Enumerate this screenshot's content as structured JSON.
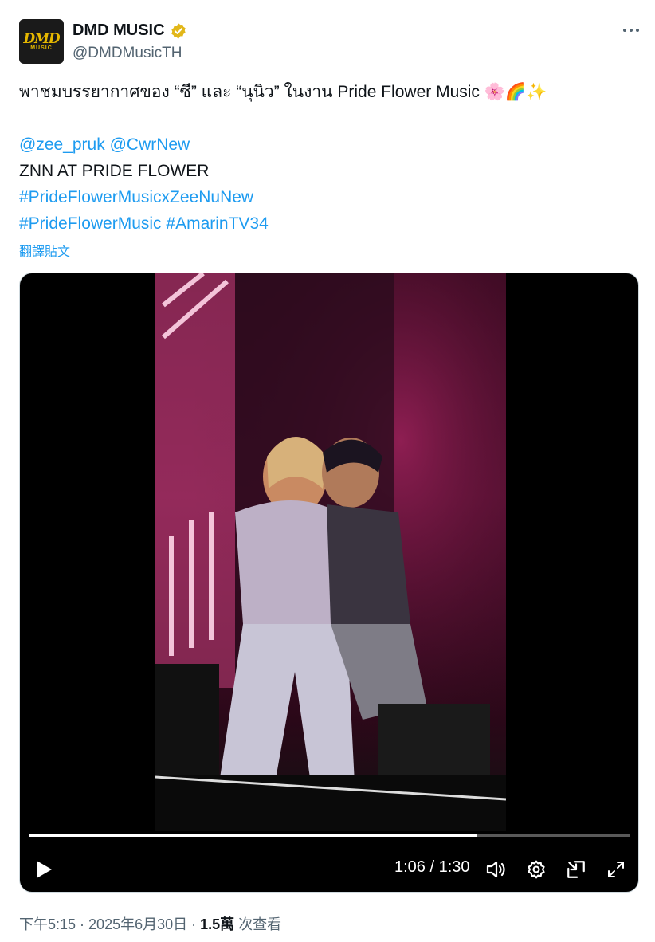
{
  "author": {
    "name": "DMD MUSIC",
    "handle": "@DMDMusicTH",
    "avatar_logo": "DMD",
    "avatar_sub": "MUSIC",
    "verified": true
  },
  "post": {
    "line1": "พาชมบรรยากาศของ “ซี” และ “นุนิว” ในงาน Pride Flower Music 🌸🌈✨",
    "mention1": "@zee_pruk",
    "mention2": "@CwrNew",
    "line3": "ZNN AT PRIDE FLOWER",
    "hashtag1": "#PrideFlowerMusicxZeeNuNew",
    "hashtag2": "#PrideFlowerMusic",
    "hashtag3": "#AmarinTV34",
    "translate_label": "翻譯貼文"
  },
  "video": {
    "current_time": "1:06",
    "duration": "1:30",
    "time_display": "1:06 / 1:30",
    "progress_fraction": 0.744
  },
  "meta": {
    "time": "下午5:15",
    "date": "2025年6月30日",
    "separator": " · ",
    "views_count": "1.5萬",
    "views_label": "次查看"
  },
  "colors": {
    "link": "#1d9bf0",
    "secondary": "#536471",
    "verified": "#e2b719"
  }
}
